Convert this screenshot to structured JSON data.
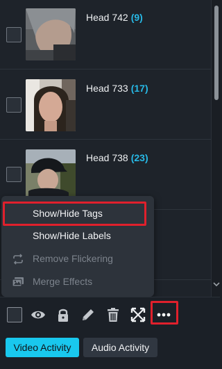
{
  "list": {
    "rows": [
      {
        "name": "Head 742",
        "count": "(9)"
      },
      {
        "name": "Head 733",
        "count": "(17)"
      },
      {
        "name": "Head 738",
        "count": "(23)"
      }
    ]
  },
  "context_menu": {
    "items": [
      {
        "label": "Show/Hide Tags",
        "enabled": true
      },
      {
        "label": "Show/Hide Labels",
        "enabled": true
      },
      {
        "label": "Remove Flickering",
        "enabled": false,
        "icon": "repeat-icon"
      },
      {
        "label": "Merge Effects",
        "enabled": false,
        "icon": "images-icon"
      }
    ]
  },
  "toolbar": {
    "icons": [
      "select-all-checkbox",
      "eye-icon",
      "lock-icon",
      "pencil-icon",
      "trash-icon",
      "expand-icon",
      "more-icon"
    ]
  },
  "tabs": {
    "video": "Video Activity",
    "audio": "Audio Activity",
    "active": "video"
  },
  "colors": {
    "accent": "#19c8ee",
    "count": "#27b9e6",
    "highlight": "#e0202c",
    "background": "#1b2027",
    "menu": "#2d333b"
  }
}
